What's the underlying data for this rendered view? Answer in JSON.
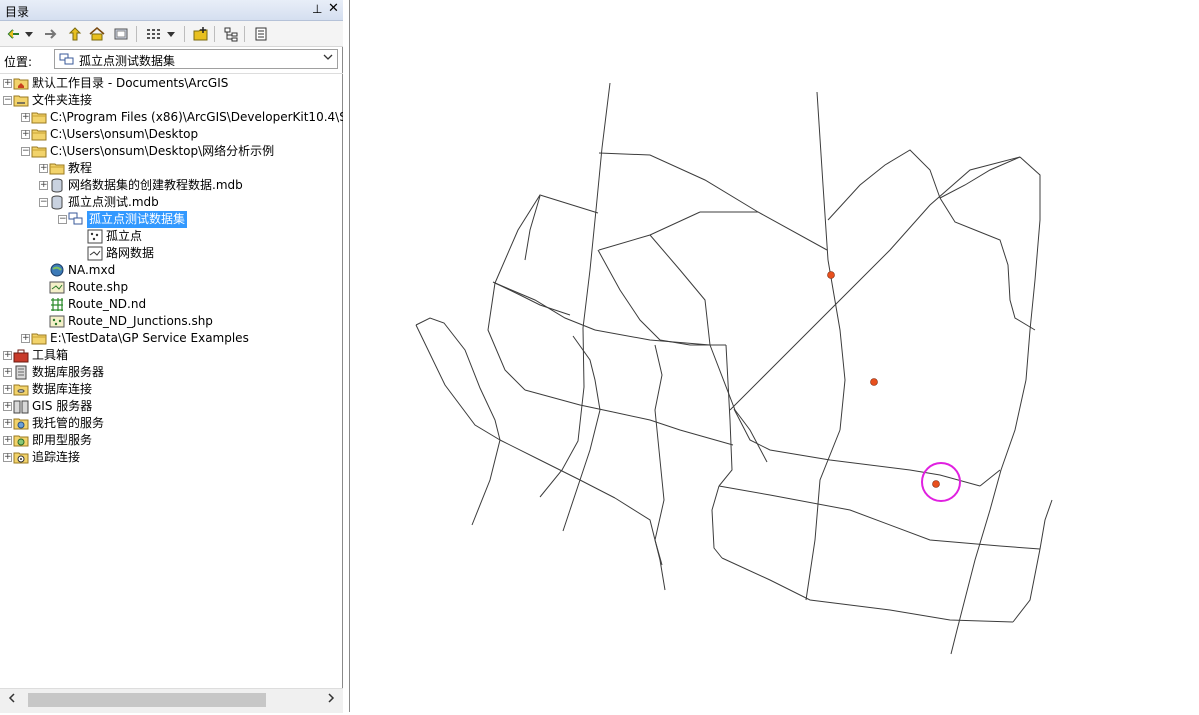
{
  "catalog": {
    "title": "目录",
    "pin_glyph": "⊥",
    "close_glyph": "✕",
    "location_label": "位置:",
    "location_value": "孤立点测试数据集",
    "toolbar_icons": [
      "back-arrow-icon",
      "dropdown-icon",
      "forward-arrow-icon",
      "up-folder-icon",
      "home-icon",
      "catalog-icon",
      "view-grid-icon",
      "view-dropdown-icon",
      "connect-folder-icon",
      "tree-view-icon",
      "options-icon"
    ],
    "tree": [
      {
        "label": "默认工作目录 - Documents\\ArcGIS",
        "icon": "home-folder-icon"
      },
      {
        "label": "文件夹连接",
        "icon": "folder-connections-icon"
      },
      {
        "label": "C:\\Program Files (x86)\\ArcGIS\\DeveloperKit10.4\\S",
        "icon": "folder-icon"
      },
      {
        "label": "C:\\Users\\onsum\\Desktop",
        "icon": "folder-icon"
      },
      {
        "label": "C:\\Users\\onsum\\Desktop\\网络分析示例",
        "icon": "folder-icon"
      },
      {
        "label": "教程",
        "icon": "folder-icon"
      },
      {
        "label": "网络数据集的创建教程数据.mdb",
        "icon": "database-icon"
      },
      {
        "label": "孤立点测试.mdb",
        "icon": "database-icon"
      },
      {
        "label": "孤立点测试数据集",
        "icon": "feature-dataset-icon"
      },
      {
        "label": "孤立点",
        "icon": "point-feature-class-icon"
      },
      {
        "label": "路网数据",
        "icon": "line-feature-class-icon"
      },
      {
        "label": "NA.mxd",
        "icon": "map-document-icon"
      },
      {
        "label": "Route.shp",
        "icon": "line-shapefile-icon"
      },
      {
        "label": "Route_ND.nd",
        "icon": "network-dataset-icon"
      },
      {
        "label": "Route_ND_Junctions.shp",
        "icon": "point-shapefile-icon"
      },
      {
        "label": "E:\\TestData\\GP Service Examples",
        "icon": "folder-icon"
      },
      {
        "label": "工具箱",
        "icon": "toolbox-icon"
      },
      {
        "label": "数据库服务器",
        "icon": "database-server-icon"
      },
      {
        "label": "数据库连接",
        "icon": "database-connection-icon"
      },
      {
        "label": "GIS 服务器",
        "icon": "gis-server-icon"
      },
      {
        "label": "我托管的服务",
        "icon": "hosted-services-icon"
      },
      {
        "label": "即用型服务",
        "icon": "ready-services-icon"
      },
      {
        "label": "追踪连接",
        "icon": "tracking-connection-icon"
      }
    ]
  },
  "colors": {
    "selection": "#3399ff",
    "point_fill": "#e8501e",
    "highlight_circle": "#e020e0",
    "road_line": "#3c3c3c"
  }
}
